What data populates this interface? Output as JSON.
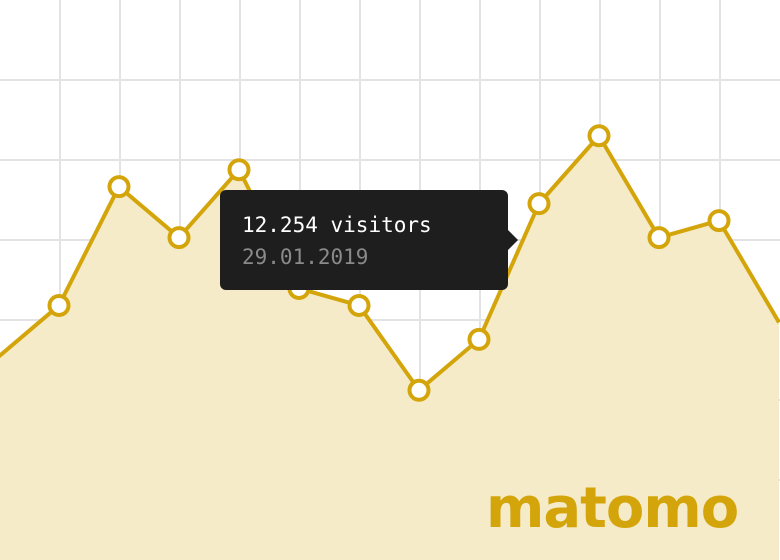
{
  "chart_data": {
    "type": "area",
    "x": [
      0,
      1,
      2,
      3,
      4,
      5,
      6,
      7,
      8,
      9,
      10,
      11,
      12,
      13
    ],
    "values": [
      7,
      10,
      17,
      14,
      18,
      11,
      10,
      5,
      8,
      16,
      20,
      14,
      15,
      9
    ],
    "ylim": [
      -5,
      28
    ],
    "grid": true,
    "colors": {
      "line": "#d4a50a",
      "fill": "#f5ebc9",
      "grid": "#e3e3e3",
      "marker_fill": "#ffffff"
    }
  },
  "tooltip": {
    "value": "12.254",
    "unit": "visitors",
    "date": "29.01.2019"
  },
  "brand": {
    "logo_text": "matomo",
    "logo_color": "#d4a50a"
  }
}
